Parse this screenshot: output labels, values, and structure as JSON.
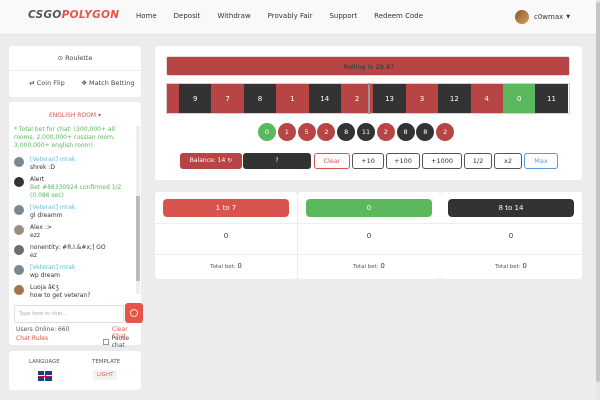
{
  "nav": {
    "logo_a": "CSGO",
    "logo_b": "POLYGON",
    "links": [
      "Home",
      "Deposit",
      "Withdraw",
      "Provably Fair",
      "Support",
      "Redeem Code"
    ],
    "username": "c0wmax"
  },
  "sidebar": {
    "roulette": "Roulette",
    "coinflip": "Coin Flip",
    "match_betting": "Match Betting",
    "room": "ENGLISH ROOM",
    "messages": [
      {
        "name": "",
        "text": "* Total bet for chat: (300,000+ all rooms, 2,000,000+ russian room, 3,000,000+ english room)",
        "style": "green"
      },
      {
        "name": "[Veteran] mrak",
        "text": "shrek :D"
      },
      {
        "name": "Alert",
        "text": "Bet #88330924 confirmed 1/2 (0.086 sec)",
        "style": "alert"
      },
      {
        "name": "[Veteran] mrak",
        "text": "gl dreamm"
      },
      {
        "name": "Alex :>",
        "text": "ezz"
      },
      {
        "name": "nonentity: #R.I.&#x;] GO",
        "text": "ez"
      },
      {
        "name": "[Veteran] mrak",
        "text": "wp dream"
      },
      {
        "name": "Luoja â€ʒ",
        "text": "how to get veteran?"
      }
    ],
    "chat_placeholder": "Type here to chat...",
    "online": "Users Online: 660",
    "clear_chat": "Clear Chat",
    "chat_rules": "Chat Rules",
    "pause_chat": "Pause chat",
    "language_label": "LANGUAGE",
    "template_label": "TEMPLATE",
    "template_value": "LIGHT"
  },
  "roulette": {
    "rolling_text": "Rolling in 29.87",
    "strip": [
      {
        "n": "",
        "c": "red",
        "half": true
      },
      {
        "n": "9",
        "c": "black"
      },
      {
        "n": "7",
        "c": "red"
      },
      {
        "n": "8",
        "c": "black"
      },
      {
        "n": "1",
        "c": "red"
      },
      {
        "n": "14",
        "c": "black"
      },
      {
        "n": "2",
        "c": "red"
      },
      {
        "n": "13",
        "c": "black"
      },
      {
        "n": "3",
        "c": "red"
      },
      {
        "n": "12",
        "c": "black"
      },
      {
        "n": "4",
        "c": "red"
      },
      {
        "n": "0",
        "c": "green"
      },
      {
        "n": "11",
        "c": "black"
      }
    ],
    "history": [
      {
        "n": "0",
        "c": "green"
      },
      {
        "n": "1",
        "c": "red"
      },
      {
        "n": "5",
        "c": "red"
      },
      {
        "n": "2",
        "c": "red"
      },
      {
        "n": "8",
        "c": "black"
      },
      {
        "n": "11",
        "c": "black"
      },
      {
        "n": "2",
        "c": "red"
      },
      {
        "n": "8",
        "c": "black"
      },
      {
        "n": "8",
        "c": "black"
      },
      {
        "n": "2",
        "c": "red"
      }
    ],
    "balance": "Balance: 14",
    "bet_value": "?",
    "buttons": [
      "Clear",
      "+10",
      "+100",
      "+1000",
      "1/2",
      "x2",
      "Max"
    ]
  },
  "columns": [
    {
      "label": "1 to 7",
      "count": "0",
      "total_label": "Total bet:",
      "total": "0",
      "color": "red"
    },
    {
      "label": "0",
      "count": "0",
      "total_label": "Total bet:",
      "total": "0",
      "color": "green"
    },
    {
      "label": "8 to 14",
      "count": "0",
      "total_label": "Total bet:",
      "total": "0",
      "color": "black"
    }
  ]
}
